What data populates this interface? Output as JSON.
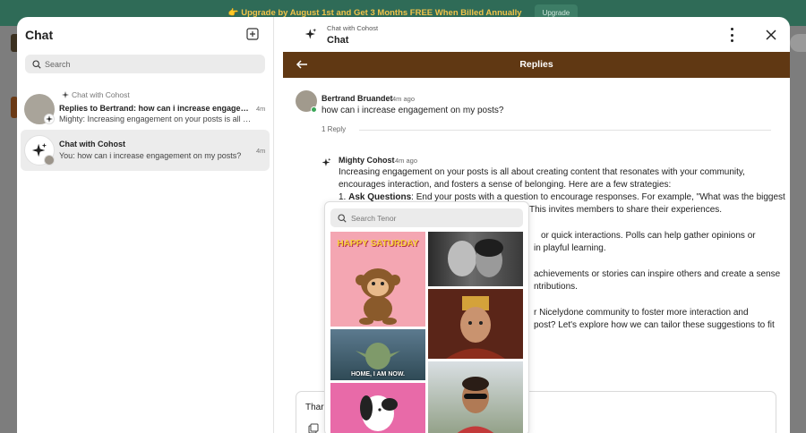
{
  "banner": {
    "text": "👉 Upgrade by August 1st and Get 3 Months FREE When Billed Annually",
    "button": "Upgrade"
  },
  "left_panel": {
    "title": "Chat",
    "search_placeholder": "Search",
    "conversations": [
      {
        "context": "Chat with Cohost",
        "title": "Replies to Bertrand: how can i increase engagement on my posts?",
        "subtitle": "Mighty: Increasing engagement on your posts is all about creating content that resonates",
        "time": "4m"
      },
      {
        "title": "Chat with Cohost",
        "subtitle": "You: how can i increase engagement on my posts?",
        "time": "4m"
      }
    ]
  },
  "right_panel": {
    "header_small": "Chat with Cohost",
    "header_title": "Chat",
    "replies_title": "Replies",
    "original_message": {
      "author": "Bertrand Bruandet",
      "time": "4m ago",
      "text": "how can i increase engagement on my posts?",
      "reply_count": "1 Reply"
    },
    "bot_message": {
      "author": "Mighty Cohost",
      "time": "4m ago",
      "intro": "Increasing engagement on your posts is all about creating content that resonates with your community, encourages interaction, and fosters a sense of belonging. Here are a few strategies:",
      "item1_label": "Ask Questions",
      "item1_text": ": End your posts with a question to encourage responses. For example, \"What was the biggest",
      "line2": "This invites members to share their experiences.",
      "line3": "or quick interactions. Polls can help gather opinions or",
      "line4": "in playful learning.",
      "line5": "achievements or stories can inspire others and create a sense",
      "line6": "ntributions.",
      "line7": "r Nicelydone community to foster more interaction and",
      "line8": "post? Let's explore how we can tailor these suggestions to fit"
    },
    "composer_text": "Thar"
  },
  "gif_picker": {
    "search_placeholder": "Search Tenor",
    "gifs": [
      {
        "caption": "HAPPY SATURDAY"
      },
      {
        "caption": "HOME, I AM NOW."
      }
    ]
  },
  "colors": {
    "banner_bg": "#2f6b57",
    "banner_text": "#f0c34a",
    "replies_bar": "#603813",
    "online": "#3aa657"
  }
}
